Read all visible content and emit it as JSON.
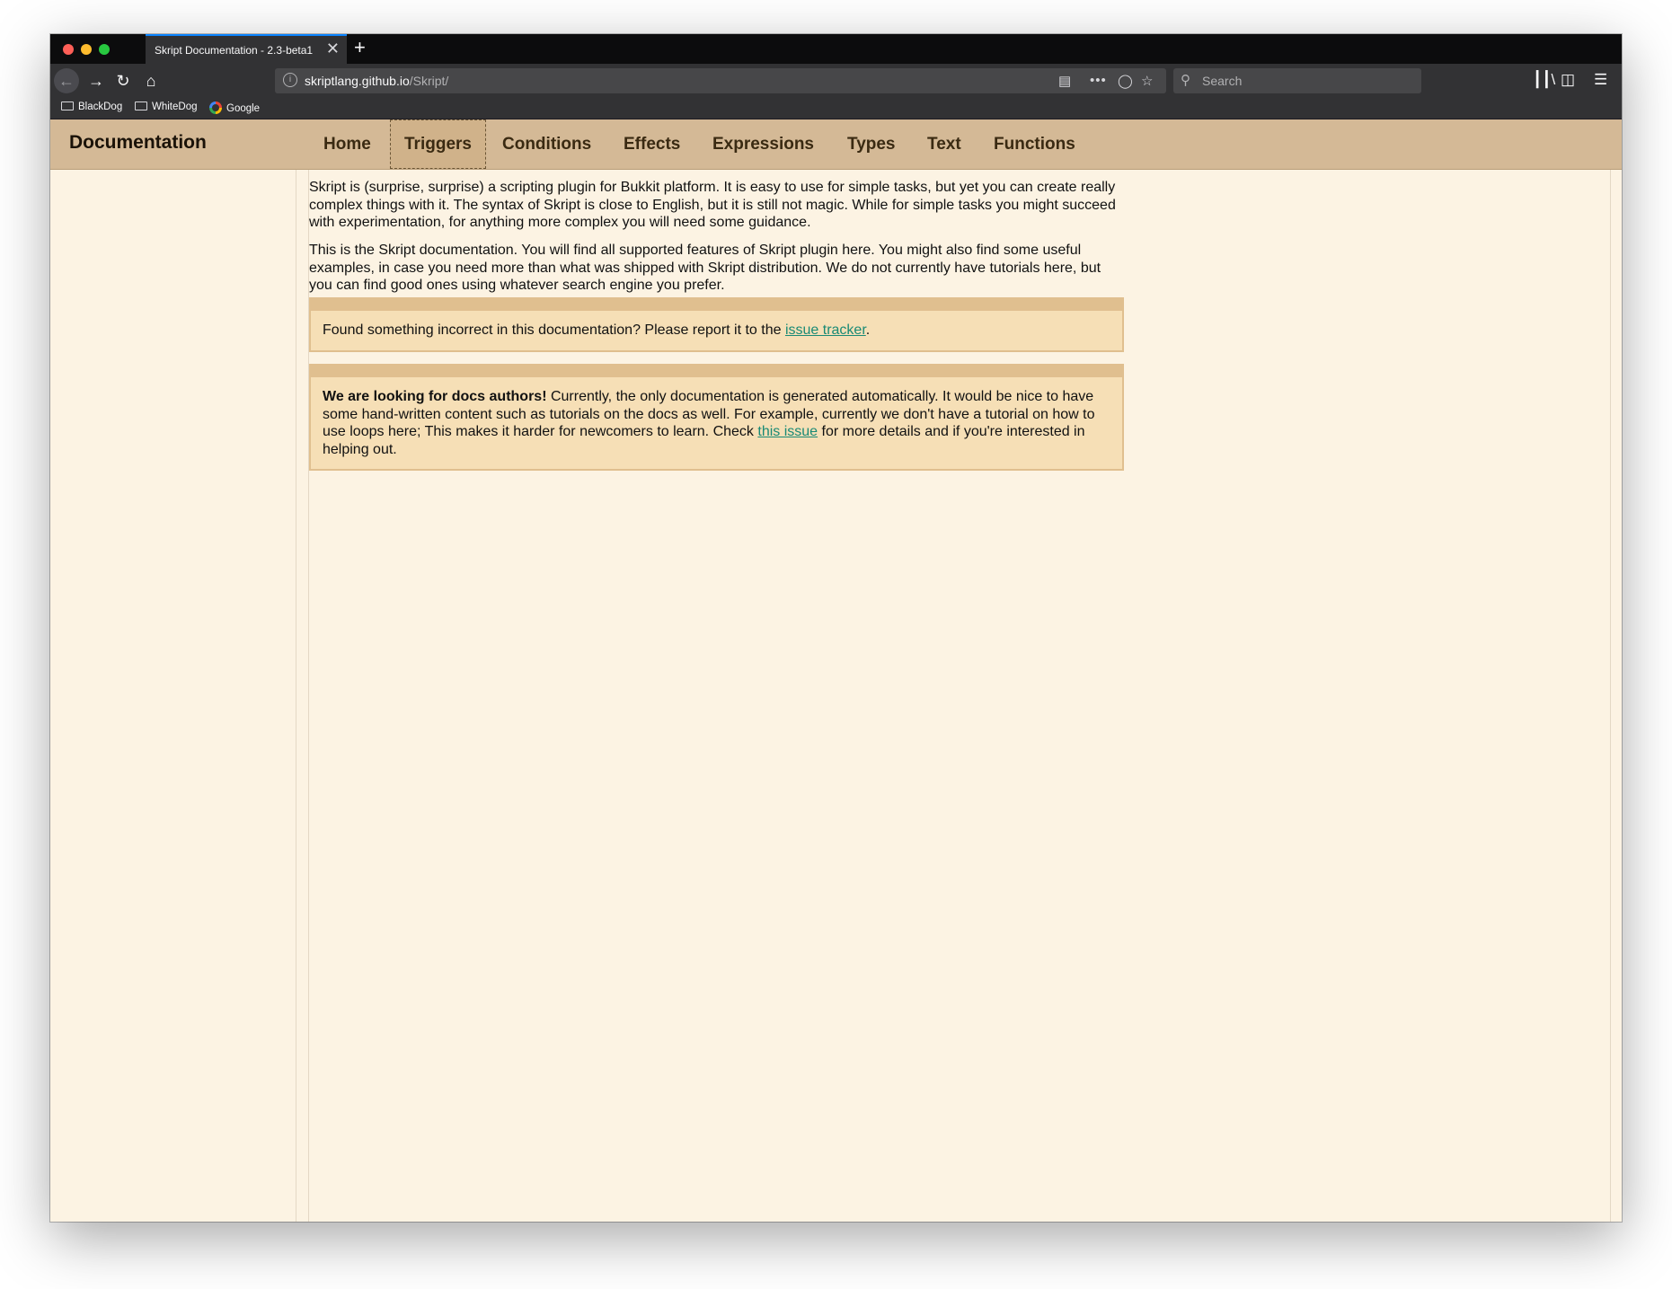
{
  "browser": {
    "tab_title": "Skript Documentation - 2.3-beta1",
    "tab_close": "✕",
    "new_tab": "+",
    "url_host": "skriptlang.github.io",
    "url_path": "/Skript/",
    "search_placeholder": "Search",
    "bookmarks": [
      {
        "label": "BlackDog",
        "icon": "folder-icon"
      },
      {
        "label": "WhiteDog",
        "icon": "folder-icon"
      },
      {
        "label": "Google",
        "icon": "google-icon"
      }
    ]
  },
  "site": {
    "brand": "Documentation",
    "nav": [
      "Home",
      "Triggers",
      "Conditions",
      "Effects",
      "Expressions",
      "Types",
      "Text",
      "Functions"
    ],
    "active_nav": "Triggers"
  },
  "content": {
    "intro_1": "Skript is (surprise, surprise) a scripting plugin for Bukkit platform. It is easy to use for simple tasks, but yet you can create really complex things with it. The syntax of Skript is close to English, but it is still not magic. While for simple tasks you might succeed with experimentation, for anything more complex you will need some guidance.",
    "intro_2": "This is the Skript documentation. You will find all supported features of Skript plugin here. You might also find some useful examples, in case you need more than what was shipped with Skript distribution. We do not currently have tutorials here, but you can find good ones using whatever search engine you prefer.",
    "notice_1": {
      "before": "Found something incorrect in this documentation? Please report it to the ",
      "link": "issue tracker",
      "after": "."
    },
    "notice_2": {
      "bold": "We are looking for docs authors!",
      "before": " Currently, the only documentation is generated automatically. It would be nice to have some hand-written content such as tutorials on the docs as well. For example, currently we don't have a tutorial on how to use loops here; This makes it harder for newcomers to learn. Check ",
      "link": "this issue",
      "after": " for more details and if you're interested in helping out."
    }
  },
  "colors": {
    "nav_bg": "#d4b996",
    "page_bg": "#fcf3e3",
    "notice_bg": "#f6dfb6",
    "link": "#198a75"
  }
}
